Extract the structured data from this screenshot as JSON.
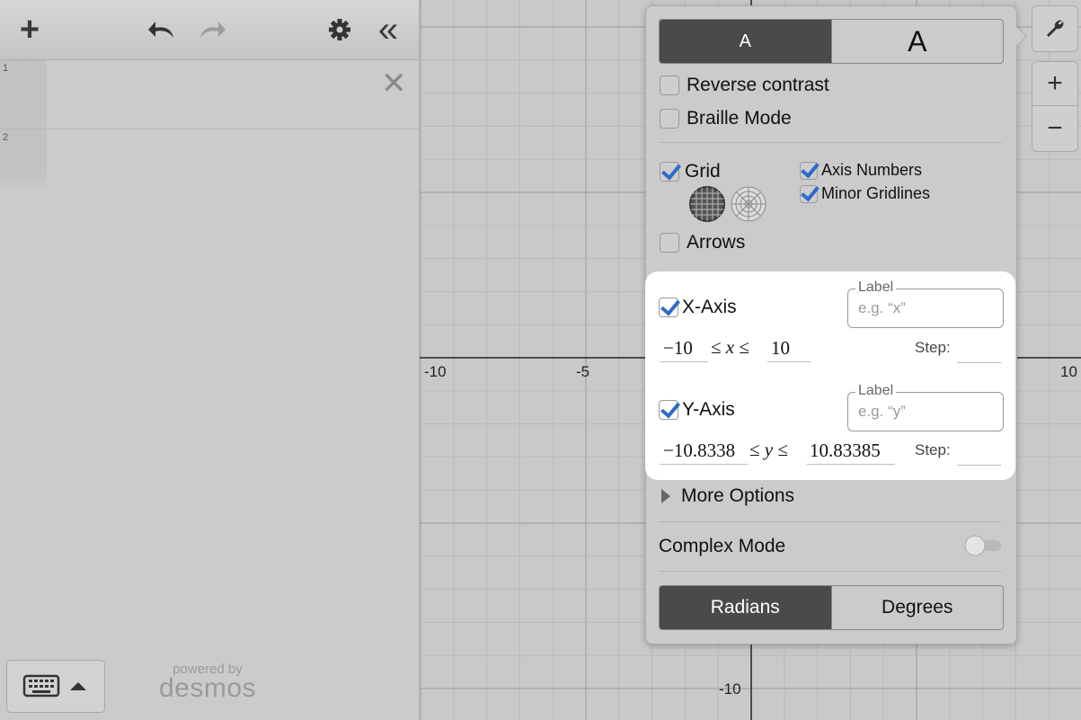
{
  "toolbar": {
    "add_label": "+",
    "collapse_label": "«"
  },
  "expressions": {
    "rows": [
      {
        "index": "1",
        "delete_label": "✕"
      },
      {
        "index": "2"
      }
    ]
  },
  "footer": {
    "powered_by": "powered by",
    "brand": "desmos"
  },
  "graph": {
    "x_ticks": [
      "-10",
      "-5",
      "10"
    ],
    "y_ticks": [
      "-10"
    ]
  },
  "zoom": {
    "in_label": "+",
    "out_label": "−"
  },
  "settings": {
    "text_size_small": "A",
    "text_size_large": "A",
    "reverse_contrast": {
      "label": "Reverse contrast",
      "checked": false
    },
    "braille_mode": {
      "label": "Braille Mode",
      "checked": false
    },
    "grid": {
      "label": "Grid",
      "checked": true
    },
    "axis_numbers": {
      "label": "Axis Numbers",
      "checked": true
    },
    "minor_gridlines": {
      "label": "Minor Gridlines",
      "checked": true
    },
    "arrows": {
      "label": "Arrows",
      "checked": false
    },
    "x_axis": {
      "label": "X-Axis",
      "checked": true,
      "label_caption": "Label",
      "label_placeholder": "e.g. “x”",
      "min": "−10",
      "var": "x",
      "max": "10",
      "step_label": "Step:"
    },
    "y_axis": {
      "label": "Y-Axis",
      "checked": true,
      "label_caption": "Label",
      "label_placeholder": "e.g. “y”",
      "min": "−10.8338",
      "var": "y",
      "max": "10.83385",
      "step_label": "Step:"
    },
    "more_options": "More Options",
    "complex_mode": {
      "label": "Complex Mode",
      "on": false
    },
    "angle_radians": "Radians",
    "angle_degrees": "Degrees",
    "angle_selected": "Radians"
  },
  "colors": {
    "accent_check": "#2f6bc9",
    "selected_segment": "#4a4a4a"
  }
}
